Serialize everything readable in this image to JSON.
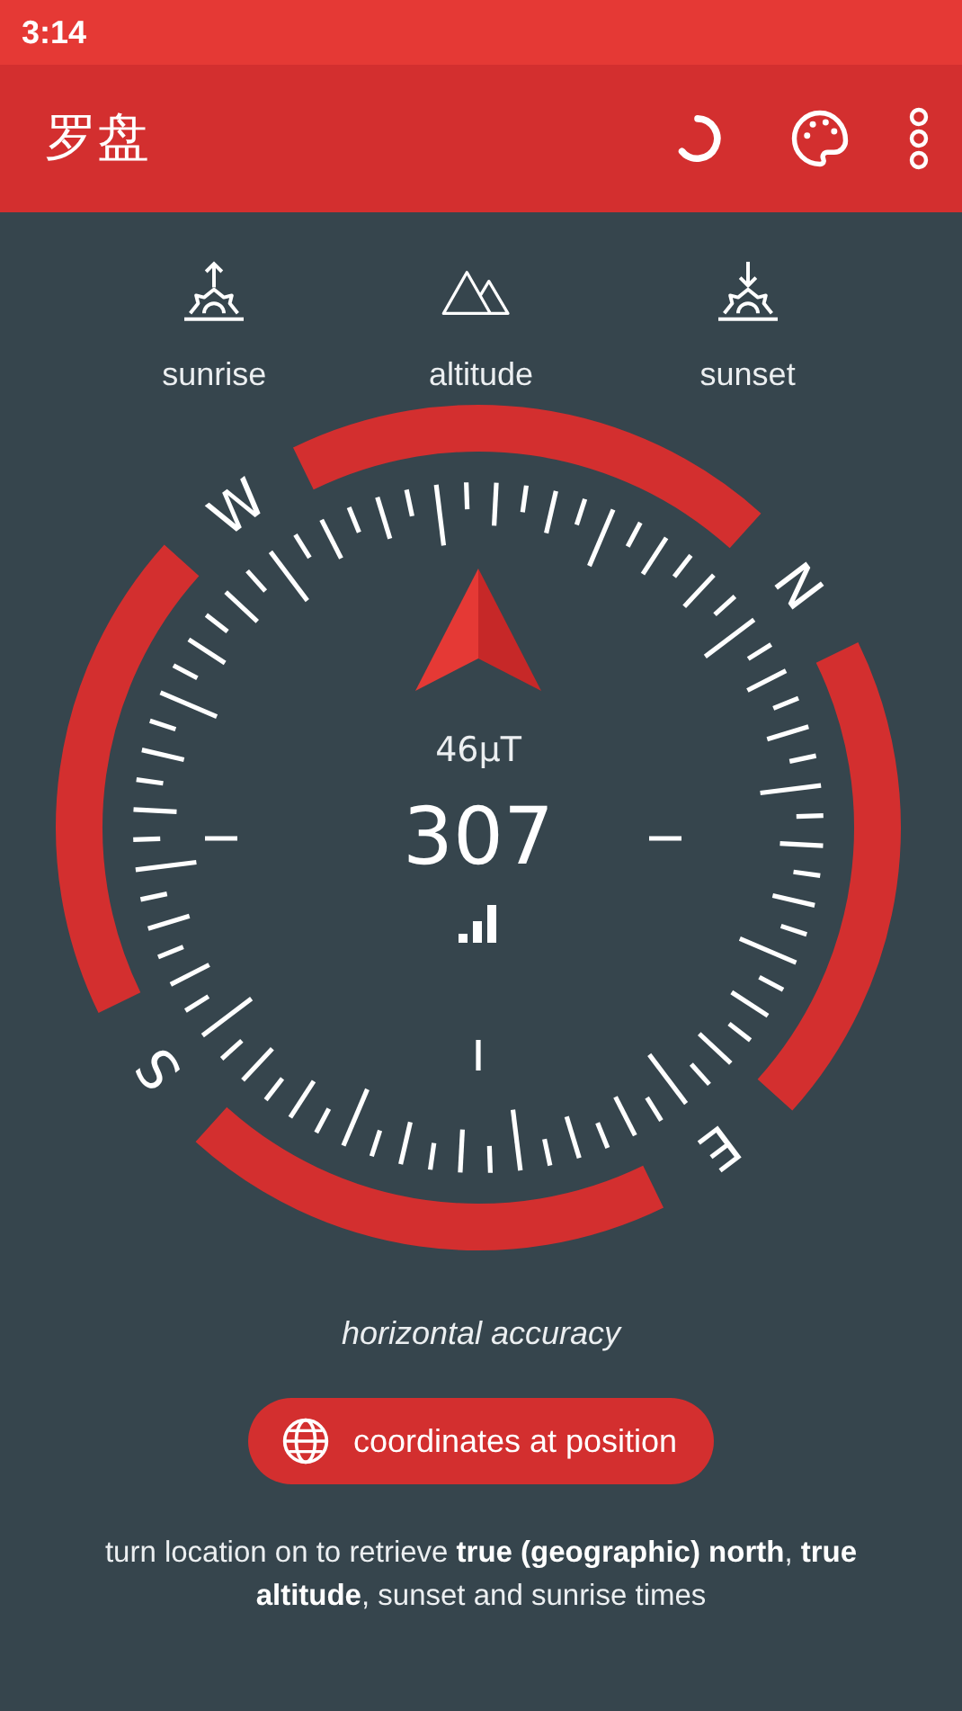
{
  "status_bar": {
    "time": "3:14"
  },
  "app_bar": {
    "title": "罗盘",
    "actions": [
      {
        "kind": "progress"
      },
      {
        "kind": "palette"
      },
      {
        "kind": "more"
      }
    ]
  },
  "info_items": [
    {
      "kind": "sunrise",
      "label": "sunrise"
    },
    {
      "kind": "altitude",
      "label": "altitude"
    },
    {
      "kind": "sunset",
      "label": "sunset"
    }
  ],
  "compass": {
    "field_strength": "46μT",
    "heading": "307",
    "cardinals": [
      "N",
      "E",
      "S",
      "W"
    ]
  },
  "accuracy_label": "horizontal accuracy",
  "location_button": {
    "label": "coordinates at position"
  },
  "note": "turn location on to retrieve **true (geographic) north**, **true altitude**, sunset and sunrise times"
}
